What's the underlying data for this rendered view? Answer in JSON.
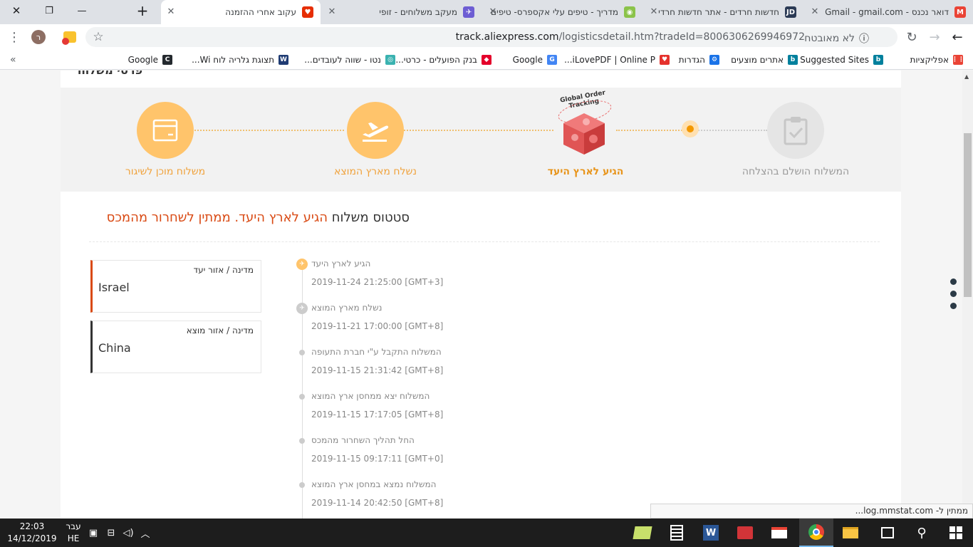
{
  "browser": {
    "tabs": [
      {
        "title": "דואר נכנס - Gmail - gmail.com",
        "fav": "M",
        "fav_color": "#ea4335",
        "active": false
      },
      {
        "title": "חדשות חרדים - אתר חדשות חרדי",
        "fav": "JD",
        "fav_color": "#2b3a55",
        "active": false
      },
      {
        "title": "מדריך - טיפים עלי אקספרס- טיפים",
        "fav": "◉",
        "fav_color": "#8bc34a",
        "active": false
      },
      {
        "title": "מעקב משלוחים - זופי",
        "fav": "✈",
        "fav_color": "#6d5dd3",
        "active": false
      },
      {
        "title": "עקוב אחרי ההזמנה",
        "fav": "♥",
        "fav_color": "#e62e04",
        "active": true
      }
    ],
    "new_tab_symbol": "+",
    "window": {
      "minimize": "—",
      "restore": "❐",
      "close": "✕"
    },
    "close_tab_symbol": "✕",
    "toolbar": {
      "back_icon": "←",
      "forward_icon": "→",
      "reload_icon": "↻",
      "info_icon": "ⓘ",
      "not_secure": "לא מאובטח",
      "url_host": "track.aliexpress.com",
      "url_path": "/logisticsdetail.htm?tradeId=8006306269946972",
      "star_icon": "☆",
      "menu_icon": "⋮",
      "profile_initial": "ר"
    },
    "bookmarks": [
      {
        "label": "אפליקציות",
        "icon_color": "#ea4335",
        "glyph": "⋮⋮"
      },
      {
        "label": "Suggested Sites",
        "icon_color": "#00809d",
        "glyph": "b"
      },
      {
        "label": "אתרים מוצעים",
        "icon_color": "#00809d",
        "glyph": "b"
      },
      {
        "label": "הגדרות",
        "icon_color": "#1a73e8",
        "glyph": "⚙"
      },
      {
        "label": "iLovePDF | Online P...",
        "icon_color": "#e5322d",
        "glyph": "♥"
      },
      {
        "label": "Google",
        "icon_color": "#4285f4",
        "glyph": "G"
      },
      {
        "label": "בנק הפועלים - כרטי...",
        "icon_color": "#e4002b",
        "glyph": "◆"
      },
      {
        "label": "נטו - שווה לעובדים...",
        "icon_color": "#3ab2b0",
        "glyph": "◎"
      },
      {
        "label": "תצוגת גלריה לוח Wi...",
        "icon_color": "#1f3b73",
        "glyph": "W"
      },
      {
        "label": "Google",
        "icon_color": "#24292e",
        "glyph": "C"
      }
    ],
    "more_bookmarks": "»"
  },
  "page": {
    "header_cut_text": "פרטי משלוח",
    "steps": [
      {
        "label": "משלוח מוכן לשיגור",
        "state": "done",
        "icon": "box-icon"
      },
      {
        "label": "נשלח מארץ המוצא",
        "state": "done",
        "icon": "plane-takeoff-icon"
      },
      {
        "label": "הגיע לארץ היעד",
        "state": "current",
        "icon": "global-order-tracking-icon",
        "badge_line1": "Global Order",
        "badge_line2": "Tracking"
      },
      {
        "label": "המשלוח הושלם בהצלחה",
        "state": "todo",
        "icon": "clipboard-check-icon"
      }
    ],
    "status": {
      "label": "סטטוס משלוח",
      "value": "הגיע לארץ היעד. ממתין לשחרור מהמכס"
    },
    "events": [
      {
        "text": "הגיע לארץ היעד",
        "datetime": "2019-11-24 21:25:00 [GMT+3]",
        "marker": "plane-landing",
        "color": "orange"
      },
      {
        "text": "נשלח מארץ המוצא",
        "datetime": "2019-11-21 17:00:00 [GMT+8]",
        "marker": "plane-takeoff",
        "color": "gray"
      },
      {
        "text": "המשלוח התקבל ע\"י חברת התעופה",
        "datetime": "2019-11-15 21:31:42 [GMT+8]",
        "marker": "dot",
        "color": "gray"
      },
      {
        "text": "המשלוח יצא ממחסן ארץ המוצא",
        "datetime": "2019-11-15 17:17:05 [GMT+8]",
        "marker": "dot",
        "color": "gray"
      },
      {
        "text": "החל תהליך השחרור מהמכס",
        "datetime": "2019-11-15 09:17:11 [GMT+0]",
        "marker": "dot",
        "color": "gray"
      },
      {
        "text": "המשלוח נמצא במחסן ארץ המוצא",
        "datetime": "2019-11-14 20:42:50 [GMT+8]",
        "marker": "dot",
        "color": "gray"
      }
    ],
    "destination": {
      "label": "מדינה / אזור יעד",
      "value": "Israel"
    },
    "origin": {
      "label": "מדינה / אזור מוצא",
      "value": "China"
    },
    "accent_color": "#d94a14",
    "orange": "#ffc46b"
  },
  "status_bubble": "ממתין ל- log.mmstat.com...",
  "taskbar": {
    "time": "22:03",
    "date": "14/12/2019",
    "lang_top": "עבר",
    "lang_bottom": "HE"
  }
}
